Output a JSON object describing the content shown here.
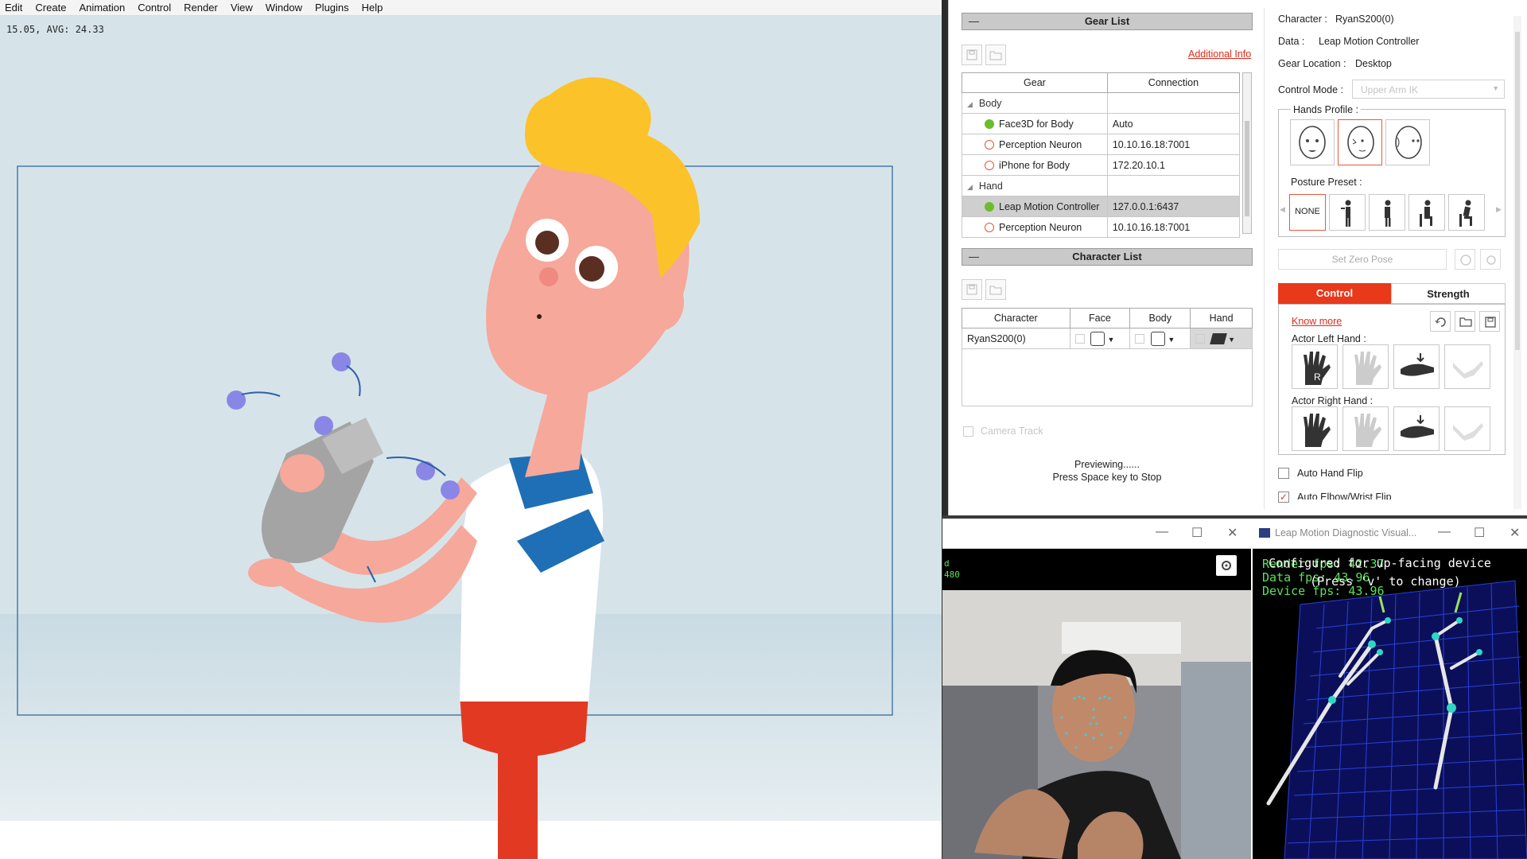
{
  "menu": [
    "Edit",
    "Create",
    "Animation",
    "Control",
    "Render",
    "View",
    "Window",
    "Plugins",
    "Help"
  ],
  "viewport": {
    "fps_text": "15.05, AVG: 24.33"
  },
  "gear_list": {
    "title": "Gear List",
    "additional_info": "Additional Info",
    "columns": [
      "Gear",
      "Connection"
    ],
    "groups": [
      {
        "name": "Body",
        "rows": [
          {
            "gear": "Face3D for Body",
            "connection": "Auto",
            "status": "connected"
          },
          {
            "gear": "Perception Neuron",
            "connection": "10.10.16.18:7001",
            "status": "disconnected"
          },
          {
            "gear": "iPhone for Body",
            "connection": "172.20.10.1",
            "status": "disconnected"
          }
        ]
      },
      {
        "name": "Hand",
        "rows": [
          {
            "gear": "Leap Motion Controller",
            "connection": "127.0.0.1:6437",
            "status": "connected"
          },
          {
            "gear": "Perception Neuron",
            "connection": "10.10.16.18:7001",
            "status": "disconnected"
          }
        ]
      }
    ]
  },
  "character_list": {
    "title": "Character List",
    "columns": [
      "Character",
      "Face",
      "Body",
      "Hand"
    ],
    "rows": [
      {
        "character": "RyanS200(0)"
      }
    ],
    "camera_track": "Camera Track",
    "preview_line1": "Previewing......",
    "preview_line2": "Press Space key to Stop"
  },
  "info": {
    "character_label": "Character :",
    "character_value": "RyanS200(0)",
    "data_label": "Data :",
    "data_value": "Leap Motion Controller",
    "gear_location_label": "Gear Location :",
    "gear_location_value": "Desktop",
    "control_mode_label": "Control Mode :",
    "control_mode_value": "Upper Arm IK"
  },
  "hands_profile": {
    "title": "Hands Profile :",
    "posture_title": "Posture Preset :",
    "none_label": "NONE"
  },
  "set_zero_pose": "Set Zero Pose",
  "tabs": {
    "control": "Control",
    "strength": "Strength"
  },
  "control": {
    "know_more": "Know more",
    "left_hand": "Actor Left Hand :",
    "right_hand": "Actor Right Hand :",
    "auto_hand_flip": "Auto Hand Flip",
    "auto_elbow": "Auto Elbow/Wrist Flip"
  },
  "webcam_window": {
    "overlay_line1": "d",
    "overlay_line2": "480"
  },
  "leap_window": {
    "title": "Leap Motion Diagnostic Visual...",
    "render_fps": "Render fps: 42.37",
    "data_fps": "Data fps: 43.96",
    "device_fps": "Device fps: 43.96",
    "configured": "Configured for up-facing device",
    "press_v": "(Press 'v' to change)"
  },
  "colors": {
    "accent": "#e8391b",
    "green": "#6cbd2b",
    "red": "#e2573f",
    "panel_head": "#c9c9c9"
  }
}
